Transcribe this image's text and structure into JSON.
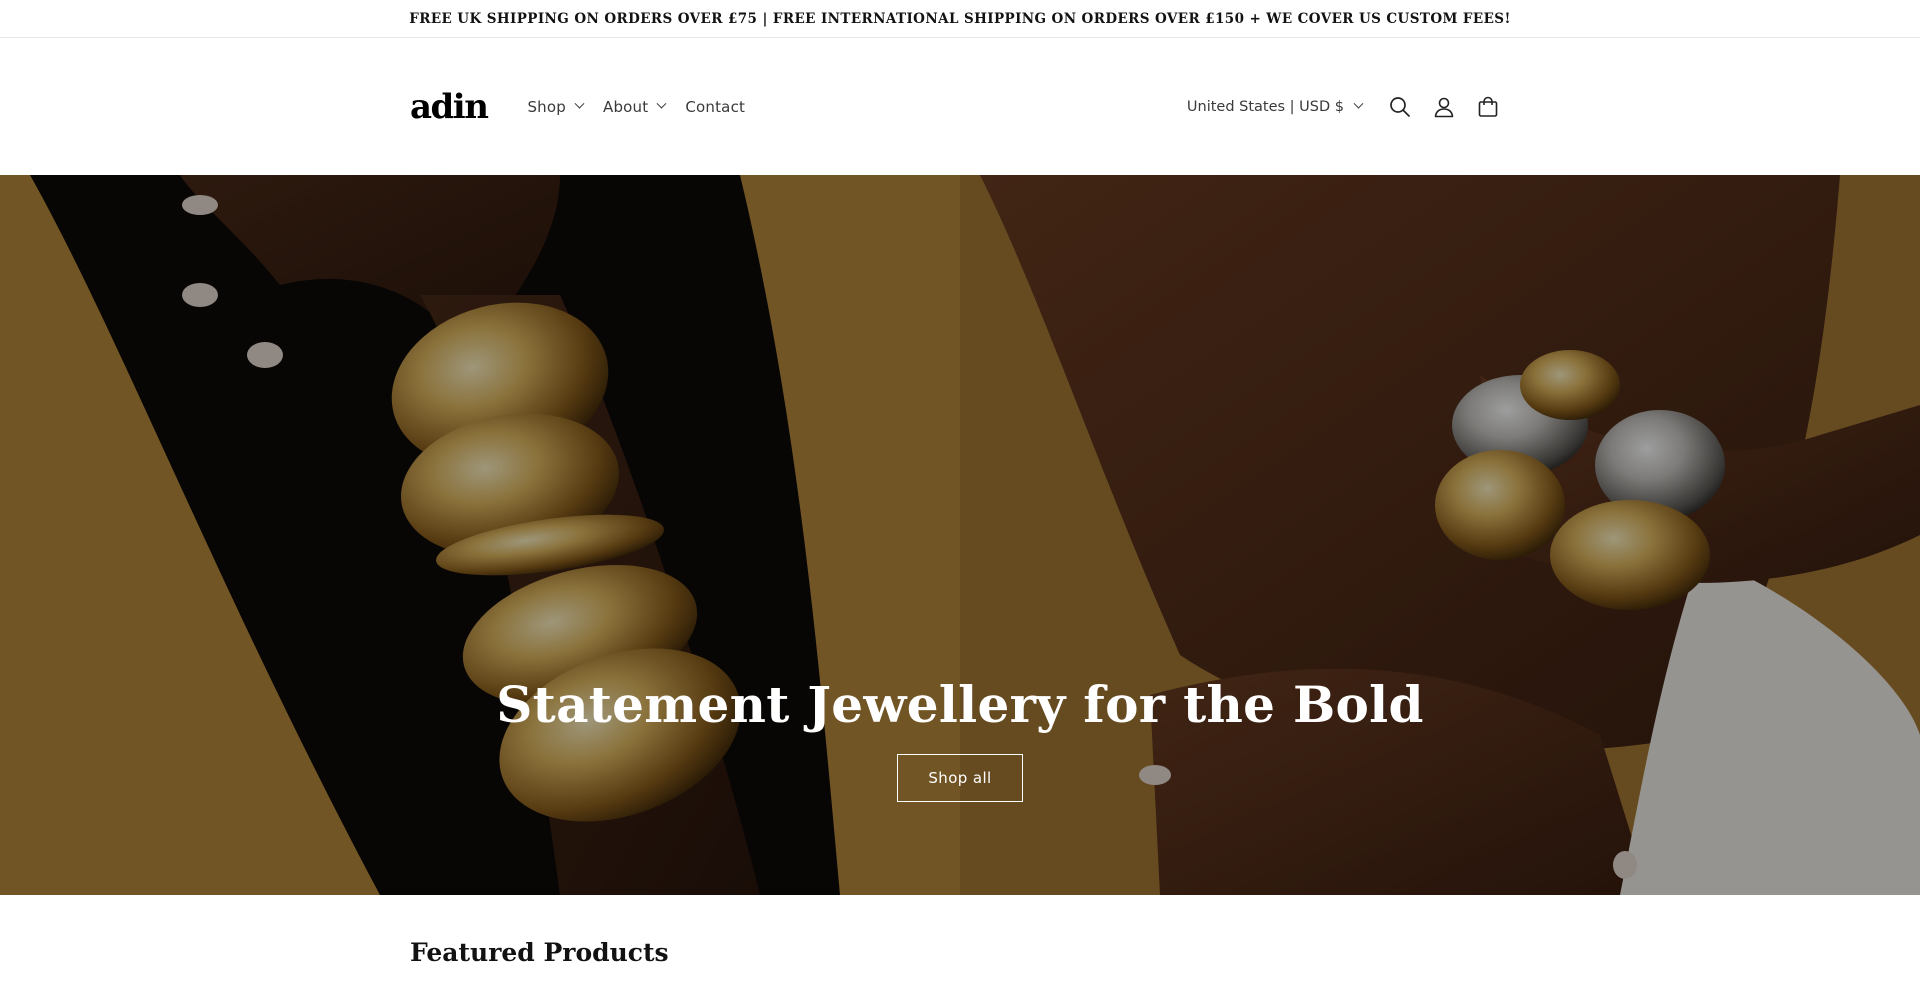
{
  "announcement": {
    "text": "FREE UK SHIPPING ON ORDERS OVER £75 | FREE INTERNATIONAL SHIPPING ON ORDERS OVER £150 + WE COVER US CUSTOM FEES!"
  },
  "header": {
    "logo": "adin",
    "nav": [
      {
        "label": "Shop",
        "has_dropdown": true
      },
      {
        "label": "About",
        "has_dropdown": true
      },
      {
        "label": "Contact",
        "has_dropdown": false
      }
    ],
    "locale": "United States | USD $",
    "icons": [
      "search-icon",
      "account-icon",
      "cart-icon"
    ]
  },
  "hero": {
    "title": "Statement Jewellery for the Bold",
    "button_label": "Shop all"
  },
  "featured": {
    "heading": "Featured Products"
  },
  "colors": {
    "text": "#121212",
    "hero_warm": "#7a5a24",
    "gold": "#c9a24a"
  }
}
